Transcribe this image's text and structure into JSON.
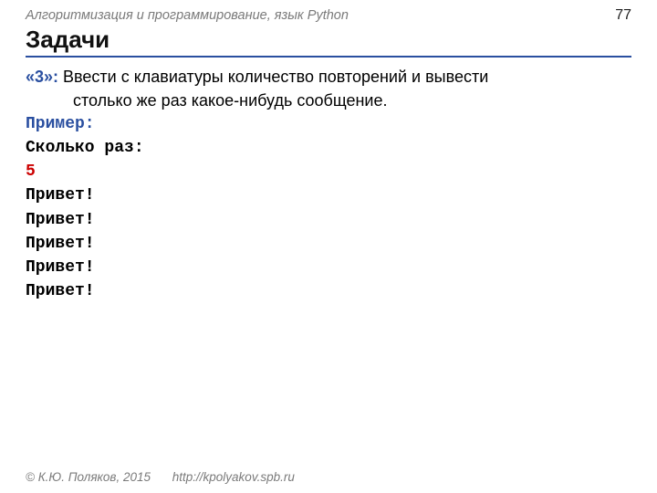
{
  "header": {
    "subject": "Алгоритмизация и программирование, язык Python",
    "page_number": "77"
  },
  "title": "Задачи",
  "task": {
    "marker": "«3»:",
    "line1": " Ввести с клавиатуры количество повторений и вывести",
    "line2": "столько же раз какое-нибудь сообщение."
  },
  "example_label": "Пример:",
  "prompt_label": "Сколько раз:",
  "input_value": "5",
  "outputs": [
    "Привет!",
    "Привет!",
    "Привет!",
    "Привет!",
    "Привет!"
  ],
  "footer": {
    "copyright": "© К.Ю. Поляков, 2015",
    "url": "http://kpolyakov.spb.ru"
  }
}
